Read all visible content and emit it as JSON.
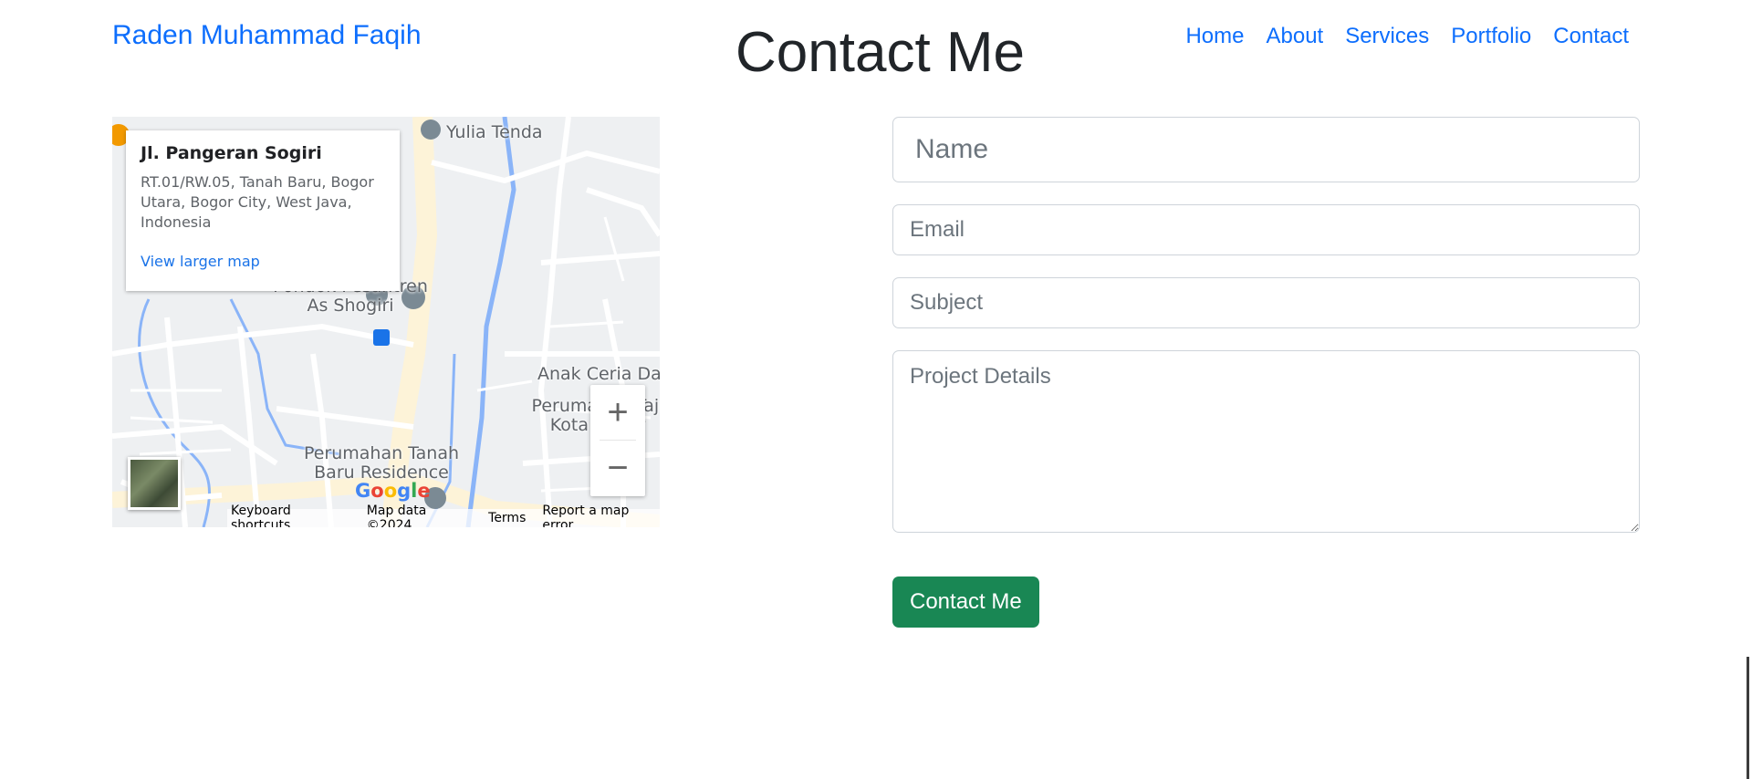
{
  "header": {
    "brand": "Raden Muhammad Faqih",
    "title": "Contact Me",
    "nav": [
      "Home",
      "About",
      "Services",
      "Portfolio",
      "Contact"
    ]
  },
  "map": {
    "place_title": "Jl. Pangeran Sogiri",
    "address": "RT.01/RW.05, Tanah Baru, Bogor Utara, Bogor City, West Java, Indonesia",
    "larger_map_link": "View larger map",
    "labels": [
      "Yulia Tenda",
      "Pondok Pesantren As Shogiri",
      "Anak Ceria Day",
      "Perumahan Taji Kota Bogor",
      "Perumahan Tanah Baru Residence"
    ],
    "google_logo": "Google",
    "footer": [
      "Keyboard shortcuts",
      "Map data ©2024",
      "Terms",
      "Report a map error"
    ],
    "zoom_in": "+",
    "zoom_out": "−"
  },
  "form": {
    "name_placeholder": "Name",
    "email_placeholder": "Email",
    "subject_placeholder": "Subject",
    "details_placeholder": "Project Details",
    "submit_label": "Contact Me"
  },
  "colors": {
    "link": "#0d6efd",
    "submit": "#198754",
    "map_bg": "#eef0f2",
    "map_road": "#ffffff",
    "map_water": "#8ab4f8"
  }
}
